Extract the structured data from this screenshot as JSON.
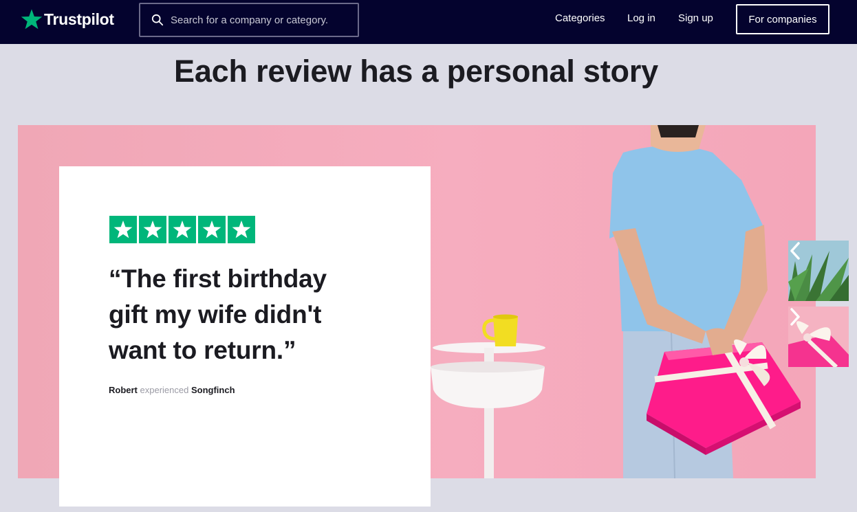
{
  "nav": {
    "logo_text": "Trustpilot",
    "search_placeholder": "Search for a company or category.",
    "links": {
      "categories": "Categories",
      "login": "Log in",
      "signup": "Sign up",
      "for_companies": "For companies"
    }
  },
  "hero": {
    "title": "Each review has a personal story"
  },
  "review": {
    "rating": 5,
    "quote_line1": "“The first birthday",
    "quote_line2": "gift my wife didn't",
    "quote_line3": "want to return.”",
    "reviewer": "Robert",
    "experienced": "experienced",
    "company": "Songfinch"
  },
  "icons": {
    "logo": "star-icon",
    "search": "search-icon",
    "rating": "star-icon",
    "prev": "chevron-left-icon",
    "next": "chevron-right-icon"
  },
  "colors": {
    "nav_bg": "#04032e",
    "brand_green": "#00b67a",
    "page_bg": "#dcdce6",
    "hero_pink": "#f4a9bb"
  }
}
